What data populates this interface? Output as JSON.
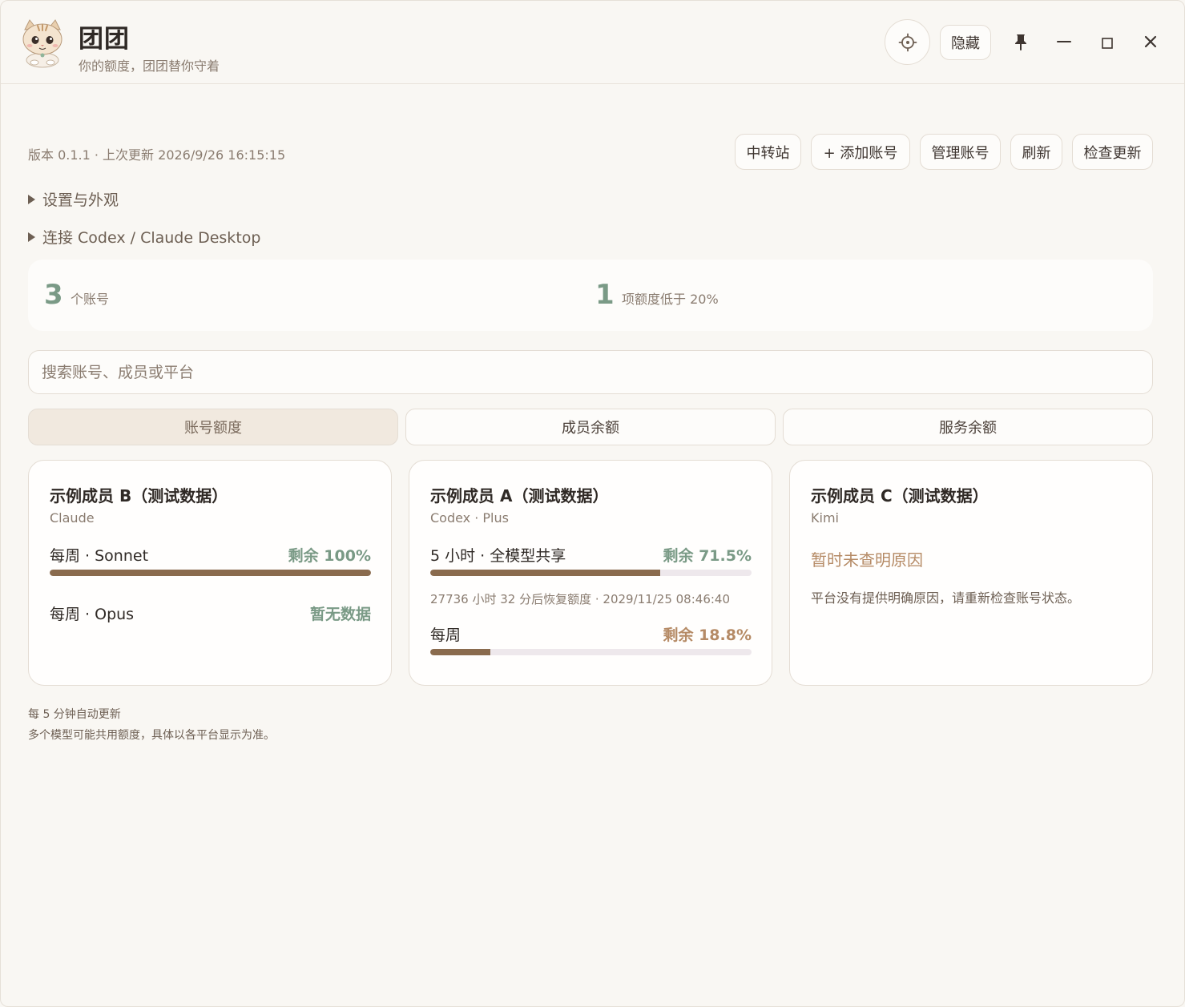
{
  "header": {
    "app_name": "团团",
    "app_subtitle": "你的额度，团团替你守着",
    "hide_label": "隐藏"
  },
  "meta": {
    "version_text": "版本 0.1.1 · 上次更新 2026/9/26 16:15:15"
  },
  "toolbar": {
    "relay_label": "中转站",
    "add_account_label": "+ 添加账号",
    "manage_accounts_label": "管理账号",
    "refresh_label": "刷新",
    "check_update_label": "检查更新"
  },
  "sections": {
    "settings_label": "设置与外观",
    "connect_label": "连接 Codex / Claude Desktop"
  },
  "stats": {
    "accounts_count": "3",
    "accounts_label": "个账号",
    "low_count": "1",
    "low_label": "项额度低于 20%"
  },
  "search": {
    "placeholder": "搜索账号、成员或平台"
  },
  "tabs": [
    {
      "label": "账号额度"
    },
    {
      "label": "成员余额"
    },
    {
      "label": "服务余额"
    }
  ],
  "cards": [
    {
      "title": "示例成员 B（测试数据）",
      "subtitle": "Claude",
      "quotas": [
        {
          "label": "每周 · Sonnet",
          "value": "剩余 100%",
          "remaining": 100
        },
        {
          "label": "每周 · Opus",
          "value": "暂无数据"
        }
      ]
    },
    {
      "title": "示例成员 A（测试数据）",
      "subtitle": "Codex · Plus",
      "quotas": [
        {
          "label": "5 小时 · 全模型共享",
          "value": "剩余 71.5%",
          "remaining": 71.5,
          "reset": "27736 小时 32 分后恢复额度 · 2029/11/25 08:46:40"
        },
        {
          "label": "每周",
          "value": "剩余 18.8%",
          "remaining": 18.8
        }
      ]
    },
    {
      "title": "示例成员 C（测试数据）",
      "subtitle": "Kimi",
      "error_title": "暂时未查明原因",
      "error_text": "平台没有提供明确原因，请重新检查账号状态。"
    }
  ],
  "footer": {
    "line1": "每 5 分钟自动更新",
    "line2": "多个模型可能共用额度，具体以各平台显示为准。"
  },
  "colors": {
    "accent_green": "#7a9a86",
    "accent_amber": "#b58a65",
    "bar_fill": "#8a6b4e"
  }
}
